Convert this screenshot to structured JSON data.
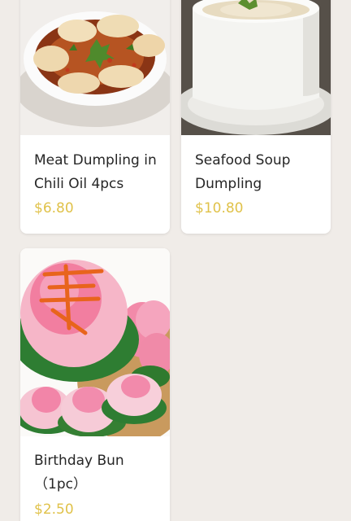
{
  "menu": {
    "items": [
      {
        "name": "Meat Dumpling in Chili Oil 4pcs",
        "price": "$6.80",
        "image_icon": "dumplings-in-chili-oil-photo"
      },
      {
        "name": "Seafood Soup Dumpling",
        "price": "$10.80",
        "image_icon": "soup-dumpling-bowl-photo"
      },
      {
        "name": "Birthday Bun\n（1pc）",
        "price": "$2.50",
        "image_icon": "peach-birthday-buns-photo"
      }
    ]
  },
  "colors": {
    "page_background": "#f0ece8",
    "card_background": "#ffffff",
    "price": "#e0c24a",
    "text": "#262626"
  }
}
